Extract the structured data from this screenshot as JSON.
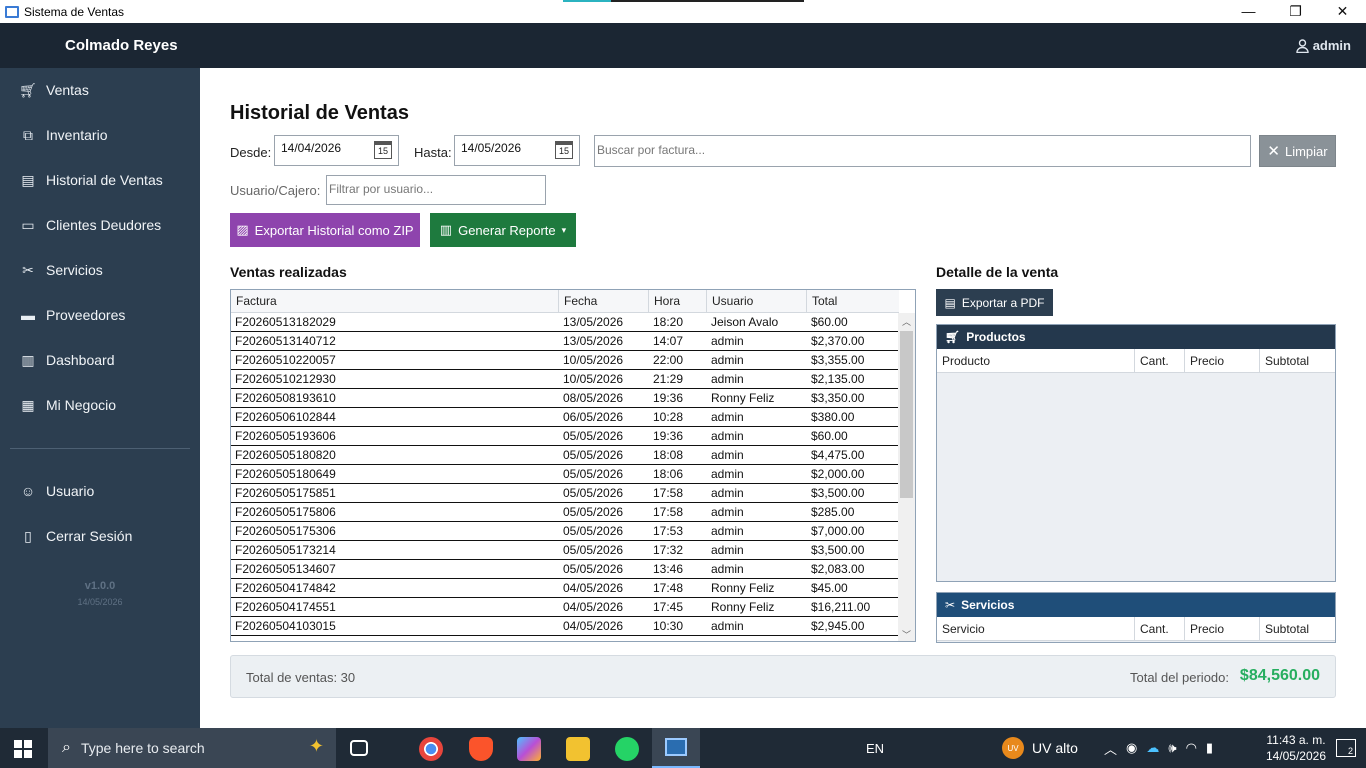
{
  "window": {
    "title": "Sistema de Ventas",
    "controls": [
      "—",
      "❐",
      "✕"
    ]
  },
  "header": {
    "brand": "Colmado Reyes",
    "user": "admin"
  },
  "sidebar": {
    "items": [
      {
        "label": "Ventas",
        "icon": "cart-icon"
      },
      {
        "label": "Inventario",
        "icon": "box-icon"
      },
      {
        "label": "Historial de Ventas",
        "icon": "document-icon"
      },
      {
        "label": "Clientes Deudores",
        "icon": "card-icon"
      },
      {
        "label": "Servicios",
        "icon": "tools-icon"
      },
      {
        "label": "Proveedores",
        "icon": "truck-icon"
      },
      {
        "label": "Dashboard",
        "icon": "chart-icon"
      },
      {
        "label": "Mi Negocio",
        "icon": "building-icon"
      }
    ],
    "bottom_items": [
      {
        "label": "Usuario",
        "icon": "user-icon"
      },
      {
        "label": "Cerrar Sesión",
        "icon": "logout-icon"
      }
    ],
    "version": "v1.0.0",
    "date": "14/05/2026"
  },
  "main": {
    "title": "Historial de Ventas",
    "desde_label": "Desde:",
    "desde_value": "14/04/2026",
    "hasta_label": "Hasta:",
    "hasta_value": "14/05/2026",
    "calendar_day": "15",
    "search_placeholder": "Buscar por factura...",
    "clear_label": "Limpiar",
    "user_filter_label": "Usuario/Cajero:",
    "user_filter_placeholder": "Filtrar por usuario...",
    "export_zip_label": "Exportar Historial como ZIP",
    "report_label": "Generar Reporte",
    "report_caret": "▾",
    "sales_title": "Ventas realizadas",
    "detail_title": "Detalle de la venta",
    "export_pdf_label": "Exportar a PDF"
  },
  "sales_table": {
    "columns": [
      "Factura",
      "Fecha",
      "Hora",
      "Usuario",
      "Total"
    ],
    "rows": [
      [
        "F20260513182029",
        "13/05/2026",
        "18:20",
        "Jeison Avalo",
        "$60.00"
      ],
      [
        "F20260513140712",
        "13/05/2026",
        "14:07",
        "admin",
        "$2,370.00"
      ],
      [
        "F20260510220057",
        "10/05/2026",
        "22:00",
        "admin",
        "$3,355.00"
      ],
      [
        "F20260510212930",
        "10/05/2026",
        "21:29",
        "admin",
        "$2,135.00"
      ],
      [
        "F20260508193610",
        "08/05/2026",
        "19:36",
        "Ronny Feliz",
        "$3,350.00"
      ],
      [
        "F20260506102844",
        "06/05/2026",
        "10:28",
        "admin",
        "$380.00"
      ],
      [
        "F20260505193606",
        "05/05/2026",
        "19:36",
        "admin",
        "$60.00"
      ],
      [
        "F20260505180820",
        "05/05/2026",
        "18:08",
        "admin",
        "$4,475.00"
      ],
      [
        "F20260505180649",
        "05/05/2026",
        "18:06",
        "admin",
        "$2,000.00"
      ],
      [
        "F20260505175851",
        "05/05/2026",
        "17:58",
        "admin",
        "$3,500.00"
      ],
      [
        "F20260505175806",
        "05/05/2026",
        "17:58",
        "admin",
        "$285.00"
      ],
      [
        "F20260505175306",
        "05/05/2026",
        "17:53",
        "admin",
        "$7,000.00"
      ],
      [
        "F20260505173214",
        "05/05/2026",
        "17:32",
        "admin",
        "$3,500.00"
      ],
      [
        "F20260505134607",
        "05/05/2026",
        "13:46",
        "admin",
        "$2,083.00"
      ],
      [
        "F20260504174842",
        "04/05/2026",
        "17:48",
        "Ronny Feliz",
        "$45.00"
      ],
      [
        "F20260504174551",
        "04/05/2026",
        "17:45",
        "Ronny Feliz",
        "$16,211.00"
      ],
      [
        "F20260504103015",
        "04/05/2026",
        "10:30",
        "admin",
        "$2,945.00"
      ]
    ]
  },
  "productos_panel": {
    "title": "Productos",
    "columns": [
      "Producto",
      "Cant.",
      "Precio",
      "Subtotal"
    ]
  },
  "servicios_panel": {
    "title": "Servicios",
    "columns": [
      "Servicio",
      "Cant.",
      "Precio",
      "Subtotal"
    ]
  },
  "summary": {
    "total_ventas": "Total de ventas: 30",
    "periodo_label": "Total del periodo:",
    "periodo_amount": "$84,560.00"
  },
  "taskbar": {
    "search_placeholder": "Type here to search",
    "language": "EN",
    "weather": "UV alto",
    "weather_badge": "UV",
    "time": "11:43 a. m.",
    "date": "14/05/2026",
    "notifications": "2"
  },
  "colors": {
    "sidebar": "#2c3e50",
    "header": "#1b2633",
    "export_zip": "#8e44ad",
    "report": "#1e7a3e",
    "total_amount": "#27ae60"
  }
}
